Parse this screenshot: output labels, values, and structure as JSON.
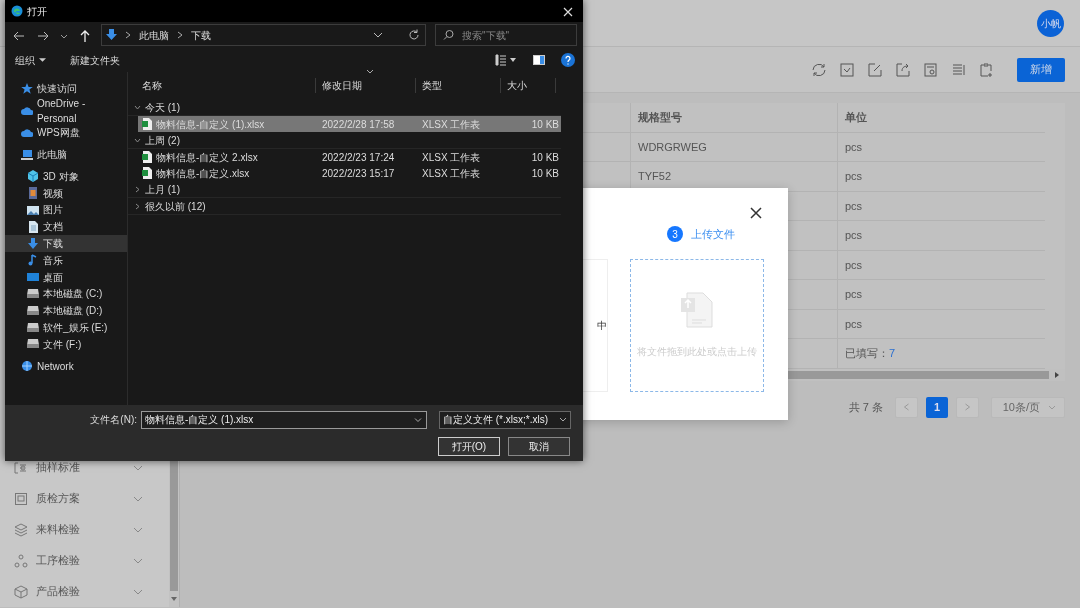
{
  "app": {
    "avatar": "小帆",
    "new_button": "新增",
    "toolbar_icons": [
      {
        "kind": "refresh"
      },
      {
        "kind": "check"
      },
      {
        "kind": "edit"
      },
      {
        "kind": "export"
      },
      {
        "kind": "document"
      },
      {
        "kind": "list"
      },
      {
        "kind": "clipboard"
      }
    ],
    "sidebar": [
      {
        "label": "抽样标准",
        "kind": "sampling"
      },
      {
        "label": "质检方案",
        "kind": "plan"
      },
      {
        "label": "来料检验",
        "kind": "layers"
      },
      {
        "label": "工序检验",
        "kind": "process"
      },
      {
        "label": "产品检验",
        "kind": "box"
      }
    ],
    "table": {
      "columns": [
        "规格型号",
        "单位"
      ],
      "rows": [
        {
          "spec": "WDRGRWEG",
          "unit": "pcs"
        },
        {
          "spec": "TYF52",
          "unit": "pcs"
        },
        {
          "unit": "pcs"
        },
        {
          "unit": "pcs"
        },
        {
          "unit": "pcs"
        },
        {
          "unit": "pcs"
        },
        {
          "unit": "pcs"
        }
      ],
      "summary": {
        "label": "已填写：",
        "count": "7"
      }
    },
    "pagination": {
      "total": "共 7 条",
      "pages": [
        {
          "label": "1",
          "selected": true
        }
      ],
      "page_size": "10条/页"
    }
  },
  "modal": {
    "step_number": "3",
    "step_label": "上传文件",
    "partial_text": "中",
    "upload_hint": "将文件拖到此处或点击上传"
  },
  "dialog": {
    "title": "打开",
    "path": [
      "此电脑",
      "下载"
    ],
    "search_placeholder": "搜索\"下载\"",
    "organize": "组织",
    "new_folder": "新建文件夹",
    "nav": [
      {
        "label": "快速访问",
        "kind": "star",
        "selected": false
      },
      {
        "label": "OneDrive - Personal",
        "kind": "cloud",
        "selected": false
      },
      {
        "label": "WPS网盘",
        "kind": "cloud",
        "selected": false
      },
      {
        "label": "此电脑",
        "kind": "pc",
        "selected": false,
        "children": [
          {
            "label": "3D 对象",
            "kind": "cube",
            "selected": false
          },
          {
            "label": "视频",
            "kind": "video",
            "selected": false
          },
          {
            "label": "图片",
            "kind": "image",
            "selected": false
          },
          {
            "label": "文档",
            "kind": "doc",
            "selected": false
          },
          {
            "label": "下载",
            "kind": "download",
            "selected": true
          },
          {
            "label": "音乐",
            "kind": "music",
            "selected": false
          },
          {
            "label": "桌面",
            "kind": "desktop",
            "selected": false
          },
          {
            "label": "本地磁盘 (C:)",
            "kind": "drive",
            "selected": false
          },
          {
            "label": "本地磁盘 (D:)",
            "kind": "drive",
            "selected": false
          },
          {
            "label": "软件_娱乐 (E:)",
            "kind": "drive",
            "selected": false
          },
          {
            "label": "文件 (F:)",
            "kind": "drive",
            "selected": false
          }
        ]
      },
      {
        "label": "Network",
        "kind": "network",
        "selected": false
      }
    ],
    "columns": [
      "名称",
      "修改日期",
      "类型",
      "大小"
    ],
    "groups": [
      {
        "label": "今天 (1)",
        "expanded": true,
        "files": [
          {
            "name": "物料信息-自定义 (1).xlsx",
            "modified": "2022/2/28 17:58",
            "type": "XLSX 工作表",
            "size": "10 KB",
            "selected": true
          }
        ]
      },
      {
        "label": "上周 (2)",
        "expanded": true,
        "files": [
          {
            "name": "物料信息-自定义 2.xlsx",
            "modified": "2022/2/23 17:24",
            "type": "XLSX 工作表",
            "size": "10 KB",
            "selected": false
          },
          {
            "name": "物料信息-自定义.xlsx",
            "modified": "2022/2/23 15:17",
            "type": "XLSX 工作表",
            "size": "10 KB",
            "selected": false
          }
        ]
      },
      {
        "label": "上月 (1)",
        "expanded": false
      },
      {
        "label": "很久以前 (12)",
        "expanded": false
      }
    ],
    "file_name_label": "文件名(N):",
    "file_name": "物料信息-自定义 (1).xlsx",
    "filter": "自定义文件 (*.xlsx;*.xls)",
    "buttons": [
      "打开(O)",
      "取消"
    ]
  }
}
